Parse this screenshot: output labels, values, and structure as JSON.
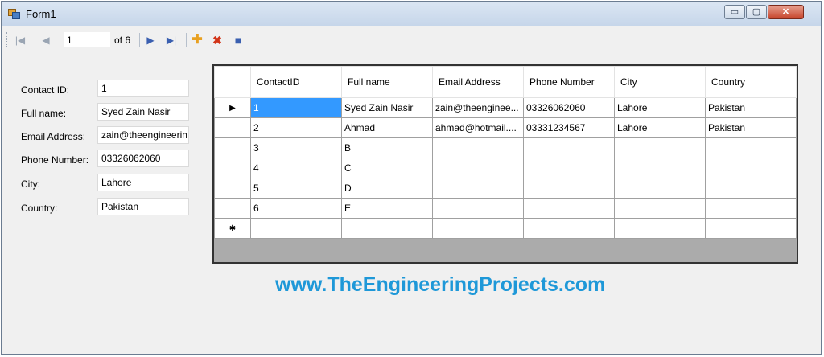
{
  "window": {
    "title": "Form1",
    "min_label": "▭",
    "max_label": "▢",
    "close_label": "✕"
  },
  "navigator": {
    "position": "1",
    "count_label": "of 6",
    "icons": [
      "move-first-icon",
      "move-previous-icon",
      "move-next-icon",
      "move-last-icon",
      "add-new-icon",
      "delete-icon",
      "save-icon"
    ]
  },
  "form": {
    "contact_id": {
      "label": "Contact ID:",
      "value": "1"
    },
    "full_name": {
      "label": "Full name:",
      "value": "Syed Zain Nasir"
    },
    "email": {
      "label": "Email Address:",
      "value": "zain@theengineerin"
    },
    "phone": {
      "label": "Phone Number:",
      "value": "03326062060"
    },
    "city": {
      "label": "City:",
      "value": "Lahore"
    },
    "country": {
      "label": "Country:",
      "value": "Pakistan"
    }
  },
  "grid": {
    "columns": [
      "ContactID",
      "Full name",
      "Email Address",
      "Phone Number",
      "City",
      "Country"
    ],
    "rows": [
      {
        "indicator": "▶",
        "cells": [
          "1",
          "Syed Zain Nasir",
          "zain@theenginee...",
          "03326062060",
          "Lahore",
          "Pakistan"
        ]
      },
      {
        "indicator": "",
        "cells": [
          "2",
          "Ahmad",
          "ahmad@hotmail....",
          "03331234567",
          "Lahore",
          "Pakistan"
        ]
      },
      {
        "indicator": "",
        "cells": [
          "3",
          "B",
          "",
          "",
          "",
          ""
        ]
      },
      {
        "indicator": "",
        "cells": [
          "4",
          "C",
          "",
          "",
          "",
          ""
        ]
      },
      {
        "indicator": "",
        "cells": [
          "5",
          "D",
          "",
          "",
          "",
          ""
        ]
      },
      {
        "indicator": "",
        "cells": [
          "6",
          "E",
          "",
          "",
          "",
          ""
        ]
      },
      {
        "indicator": "✱",
        "cells": [
          "",
          "",
          "",
          "",
          "",
          ""
        ]
      }
    ]
  },
  "watermark": "www.TheEngineeringProjects.com",
  "colors": {
    "selection": "#3399ff",
    "watermark": "#1e98d8",
    "close_button": "#c6452c"
  }
}
